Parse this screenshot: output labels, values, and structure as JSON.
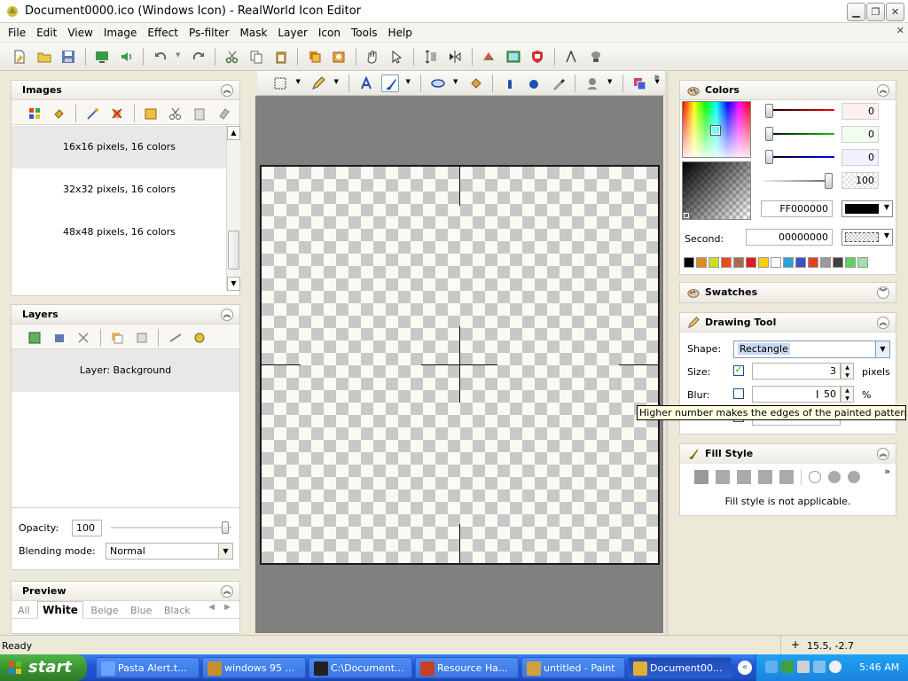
{
  "window": {
    "title": "Document0000.ico (Windows Icon) - RealWorld Icon Editor",
    "buttons": [
      "minimize",
      "restore",
      "close"
    ]
  },
  "menu": [
    "File",
    "Edit",
    "View",
    "Image",
    "Effect",
    "Ps-filter",
    "Mask",
    "Layer",
    "Icon",
    "Tools",
    "Help"
  ],
  "images_panel": {
    "title": "Images",
    "items": [
      "16x16 pixels, 16 colors",
      "32x32 pixels, 16 colors",
      "48x48 pixels, 16 colors"
    ],
    "selected_index": 0
  },
  "layers_panel": {
    "title": "Layers",
    "items": [
      "Layer: Background"
    ],
    "opacity_label": "Opacity:",
    "opacity_value": "100",
    "blend_label": "Blending mode:",
    "blend_value": "Normal"
  },
  "preview_panel": {
    "title": "Preview",
    "tabs": [
      "All",
      "White",
      "Beige",
      "Blue",
      "Black"
    ],
    "active_tab": "White"
  },
  "colors_panel": {
    "title": "Colors",
    "r": "0",
    "g": "0",
    "b": "0",
    "a": "100",
    "hex": "FF000000",
    "second_label": "Second:",
    "second_hex": "00000000",
    "palette": [
      "#000000",
      "#e08a1e",
      "#c8e020",
      "#f04a1a",
      "#a86a48",
      "#e01a1a",
      "#ffd000",
      "#ffffff",
      "#2aa0e0",
      "#4050c0",
      "#e04020",
      "#9a9a9a",
      "#404040",
      "#60d060",
      "#a0e0a0"
    ]
  },
  "swatches_panel": {
    "title": "Swatches"
  },
  "drawing_tool_panel": {
    "title": "Drawing Tool",
    "shape_label": "Shape:",
    "shape_value": "Rectangle",
    "size_label": "Size:",
    "size_value": "3",
    "size_unit": "pixels",
    "blur_label": "Blur:",
    "blur_value": "50",
    "blur_unit": "%",
    "tooltip": "Higher number makes the edges of the painted pattern blurry."
  },
  "fill_style_panel": {
    "title": "Fill Style",
    "message": "Fill style is not applicable."
  },
  "statusbar": {
    "text": "Ready",
    "coords": "15.5, -2.7"
  },
  "taskbar": {
    "start": "start",
    "tasks": [
      {
        "label": "Pasta Alert.t...",
        "color": "#6aa3ff"
      },
      {
        "label": "windows 95 ...",
        "color": "#c8902a"
      },
      {
        "label": "C:\\Document...",
        "color": "#222222"
      },
      {
        "label": "Resource Ha...",
        "color": "#c84020"
      },
      {
        "label": "untitled - Paint",
        "color": "#d0a040"
      },
      {
        "label": "Document00...",
        "color": "#e0b030"
      }
    ],
    "clock": "5:46 AM"
  }
}
